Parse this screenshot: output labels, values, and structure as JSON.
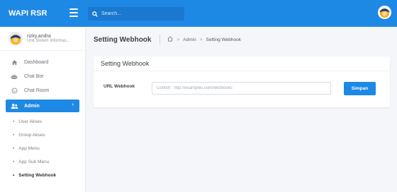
{
  "app": {
    "brand": "WAPI RSR"
  },
  "search": {
    "placeholder": "Search..."
  },
  "user": {
    "name": "rizky.andra",
    "role": "Unit Sistem Informas..."
  },
  "sidebar": {
    "items": [
      {
        "label": "Dashboard",
        "icon": "home-icon"
      },
      {
        "label": "Chat Bot",
        "icon": "robot-icon"
      },
      {
        "label": "Chat Room",
        "icon": "whatsapp-icon"
      },
      {
        "label": "Admin",
        "icon": "users-icon",
        "active": true
      }
    ],
    "submenu": [
      {
        "label": "User Akses"
      },
      {
        "label": "Group Akses"
      },
      {
        "label": "App Menu"
      },
      {
        "label": "App Sub Menu"
      },
      {
        "label": "Setting Webhook",
        "current": true
      }
    ],
    "active_chevron": "›"
  },
  "header": {
    "title": "Setting Webhook",
    "breadcrumb": {
      "sep": ">",
      "admin": "Admin",
      "current": "Setting Webhook"
    }
  },
  "card": {
    "title": "Setting Webhook",
    "form": {
      "label": "URL Webhook",
      "placeholder": "Contoh : http://examples.com/webhooks",
      "value": "",
      "button": "Simpan"
    }
  },
  "colors": {
    "primary": "#1e88e5",
    "background": "#f4f6f9"
  }
}
